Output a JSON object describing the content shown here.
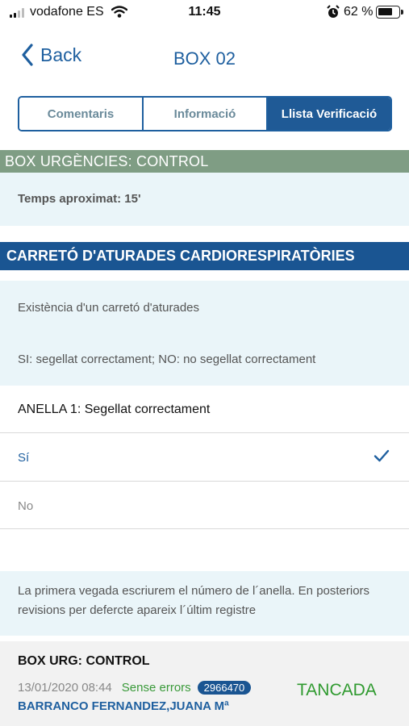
{
  "status_bar": {
    "carrier": "vodafone ES",
    "time": "11:45",
    "battery": "62 %",
    "battery_level": 0.62,
    "icons": [
      "signal-icon",
      "wifi-icon",
      "alarm-icon",
      "battery-icon"
    ]
  },
  "nav": {
    "back_label": "Back",
    "title": "BOX 02"
  },
  "tabs": [
    {
      "label": "Comentaris",
      "active": false
    },
    {
      "label": "Informació",
      "active": false
    },
    {
      "label": "Llista Verificació",
      "active": true
    }
  ],
  "section": {
    "header": "BOX URGÈNCIES: CONTROL",
    "time_text": "Temps aproximat: 15'"
  },
  "item": {
    "header": "CARRETÓ D'ATURADES CARDIORESPIRATÒRIES",
    "description_line1": "Existència d'un carretó d'aturades",
    "description_line2": "SI: segellat correctament; NO: no segellat correctament",
    "question": "ANELLA 1: Segellat correctament",
    "options": [
      {
        "label": "Sí",
        "selected": true
      },
      {
        "label": "No",
        "selected": false
      }
    ],
    "note": "La primera vegada escriurem el número de l´anella. En posteriors revisions per defercte apareix l´últim registre"
  },
  "footer": {
    "title": "BOX URG: CONTROL",
    "date": "13/01/2020 08:44",
    "errors": "Sense errors",
    "badge": "2966470",
    "status": "TANCADA",
    "name": "BARRANCO FERNANDEZ,JUANA Mª"
  },
  "colors": {
    "accent": "#1e5f9f",
    "header_green": "#7f9d84",
    "header_blue": "#1a5592",
    "status_green": "#2f9a2f",
    "panel_bg": "#eaf5f9"
  }
}
